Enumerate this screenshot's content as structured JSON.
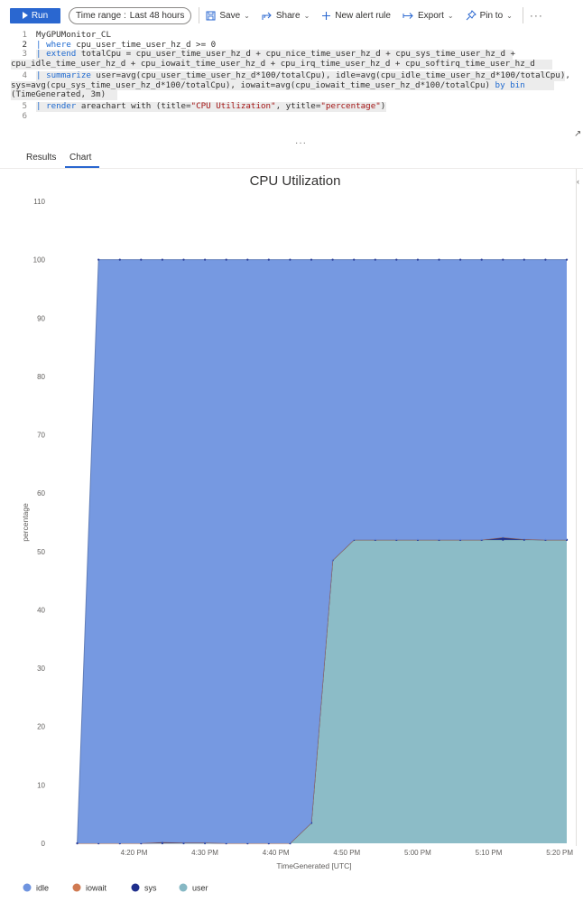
{
  "toolbar": {
    "run_label": "Run",
    "time_range_label": "Time range :",
    "time_range_value": "Last 48 hours",
    "save_label": "Save",
    "share_label": "Share",
    "new_alert_label": "New alert rule",
    "export_label": "Export",
    "pin_label": "Pin to",
    "more_label": "···"
  },
  "editor": {
    "lines": [
      {
        "num": "1",
        "text": "MyGPUMonitor_CL"
      },
      {
        "num": "2",
        "text": "| where cpu_user_time_user_hz_d >= 0"
      },
      {
        "num": "3",
        "text": "| extend totalCpu = cpu_user_time_user_hz_d + cpu_nice_time_user_hz_d + cpu_sys_time_user_hz_d +"
      },
      {
        "num": "",
        "text": "cpu_idle_time_user_hz_d + cpu_iowait_time_user_hz_d + cpu_irq_time_user_hz_d + cpu_softirq_time_user_hz_d"
      },
      {
        "num": "4",
        "text": "| summarize user=avg(cpu_user_time_user_hz_d*100/totalCpu), idle=avg(cpu_idle_time_user_hz_d*100/totalCpu),"
      },
      {
        "num": "",
        "text": "sys=avg(cpu_sys_time_user_hz_d*100/totalCpu), iowait=avg(cpu_iowait_time_user_hz_d*100/totalCpu) by bin"
      },
      {
        "num": "",
        "text": "(TimeGenerated, 3m)"
      },
      {
        "num": "5",
        "text": "| render areachart with (title=\"CPU Utilization\", ytitle=\"percentage\")"
      },
      {
        "num": "6",
        "text": ""
      }
    ]
  },
  "tabs": [
    {
      "label": "Results"
    },
    {
      "label": "Chart"
    }
  ],
  "colors": {
    "idle": "#6f94df",
    "iowait": "#d07a52",
    "sys": "#1f2f8c",
    "user": "#86b8c4",
    "accent": "#2a67d0"
  },
  "chart_data": {
    "type": "area",
    "title": "CPU Utilization",
    "xlabel": "TimeGenerated [UTC]",
    "ylabel": "percentage",
    "ylim": [
      0,
      110
    ],
    "yticks": [
      0,
      10,
      20,
      30,
      40,
      50,
      60,
      70,
      80,
      90,
      100,
      110
    ],
    "xticks": [
      "4:20 PM",
      "4:30 PM",
      "4:40 PM",
      "4:50 PM",
      "5:00 PM",
      "5:10 PM",
      "5:20 PM"
    ],
    "x_minutes": [
      252,
      255,
      258,
      261,
      264,
      267,
      270,
      273,
      276,
      279,
      282,
      285,
      288,
      291,
      294,
      297,
      300,
      303,
      306,
      309,
      312,
      315,
      318,
      321
    ],
    "x_tick_minutes": [
      260,
      270,
      280,
      290,
      300,
      310,
      320
    ],
    "x_range_minutes": [
      249,
      321
    ],
    "legend_position": "bottom-left",
    "grid": false,
    "series": [
      {
        "name": "user",
        "values": [
          0,
          0,
          0,
          0,
          0,
          0,
          0,
          0,
          0,
          0,
          0,
          3.5,
          48.5,
          52,
          52,
          52,
          52,
          52,
          52,
          52,
          52,
          52,
          52,
          52
        ]
      },
      {
        "name": "sys",
        "values": [
          0,
          0,
          0,
          0,
          0.1,
          0.1,
          0.1,
          0,
          0,
          0,
          0,
          0,
          0,
          0,
          0,
          0,
          0,
          0,
          0,
          0,
          0.4,
          0.1,
          0,
          0
        ]
      },
      {
        "name": "iowait",
        "values": [
          0,
          0,
          0,
          0,
          0.1,
          0,
          0,
          0,
          0,
          0,
          0,
          0,
          0,
          0,
          0,
          0,
          0,
          0,
          0,
          0,
          0,
          0,
          0,
          0
        ]
      },
      {
        "name": "idle",
        "values": [
          0,
          100,
          100,
          100,
          99.8,
          99.9,
          99.9,
          100,
          100,
          100,
          100,
          96.5,
          51.5,
          48,
          48,
          48,
          48,
          48,
          48,
          48,
          47.6,
          47.9,
          48,
          48
        ]
      }
    ]
  }
}
